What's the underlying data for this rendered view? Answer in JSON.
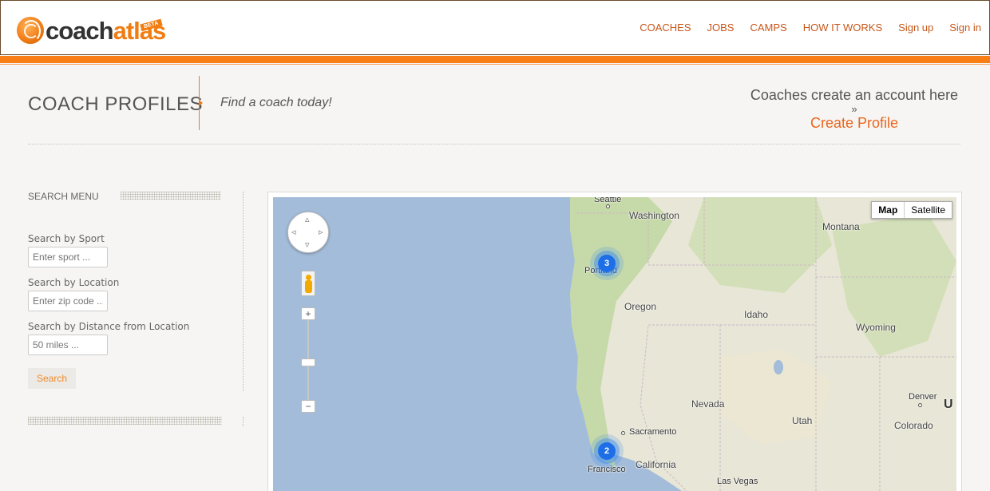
{
  "header": {
    "logo": {
      "part1": "coach",
      "part2": "atlas",
      "badge": "BETA"
    },
    "nav": [
      {
        "label": "COACHES"
      },
      {
        "label": "JOBS"
      },
      {
        "label": "CAMPS"
      },
      {
        "label": "HOW IT WORKS"
      },
      {
        "label": "Sign up"
      },
      {
        "label": "Sign in"
      }
    ]
  },
  "page": {
    "title": "COACH PROFILES",
    "tagline": "Find a coach today!",
    "promo": {
      "text": "Coaches create an account here",
      "arrow": "»",
      "link": "Create Profile"
    }
  },
  "sidebar": {
    "title": "SEARCH MENU",
    "sport": {
      "label": "Search by Sport",
      "placeholder": "Enter sport ..."
    },
    "location": {
      "label": "Search by Location",
      "placeholder": "Enter zip code ..."
    },
    "distance": {
      "label": "Search by Distance from Location",
      "value": "50 miles ..."
    },
    "search_button": "Search"
  },
  "map": {
    "type_buttons": {
      "map": "Map",
      "satellite": "Satellite"
    },
    "clusters": [
      {
        "count": "3",
        "near": "Portland"
      },
      {
        "count": "2",
        "near": "San Francisco"
      }
    ],
    "labels": {
      "seattle": "Seattle",
      "washington": "Washington",
      "montana": "Montana",
      "portland": "Portland",
      "oregon": "Oregon",
      "idaho": "Idaho",
      "wyoming": "Wyoming",
      "nevada": "Nevada",
      "utah": "Utah",
      "denver": "Denver",
      "colorado": "Colorado",
      "sacramento": "Sacramento",
      "california": "California",
      "francisco": "Francisco",
      "las_vegas": "Las Vegas",
      "edge": "U"
    },
    "colors": {
      "water": "#a3bcd9",
      "land": "#e8e6d6",
      "forest": "#c6d9a8",
      "cluster": "#1e6ee8"
    }
  }
}
